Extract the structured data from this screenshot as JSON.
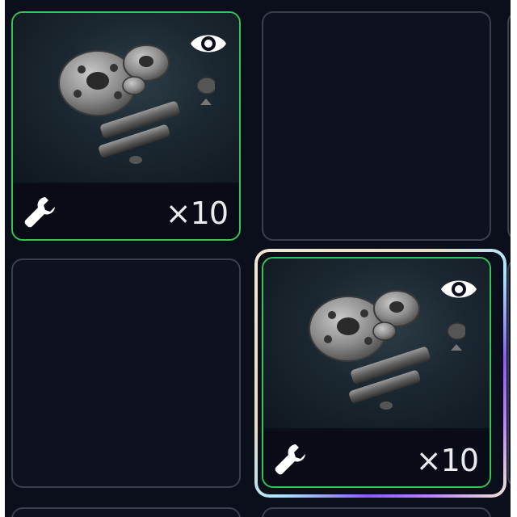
{
  "slots": [
    {
      "name": "slot-1",
      "state": "item",
      "count": "×10",
      "icon": "wrench-icon",
      "preview_icon": "eye-icon",
      "rarity_color": "#36c455"
    },
    {
      "name": "slot-2",
      "state": "empty"
    },
    {
      "name": "slot-3",
      "state": "empty"
    },
    {
      "name": "slot-4",
      "state": "item",
      "selected": true,
      "count": "×10",
      "icon": "wrench-icon",
      "preview_icon": "eye-icon",
      "rarity_color": "#36c455"
    }
  ],
  "colors": {
    "background": "#0b0f1c",
    "slot_border": "#3a3f50",
    "rarity_green": "#36c455",
    "count_text": "#e9ecef"
  }
}
